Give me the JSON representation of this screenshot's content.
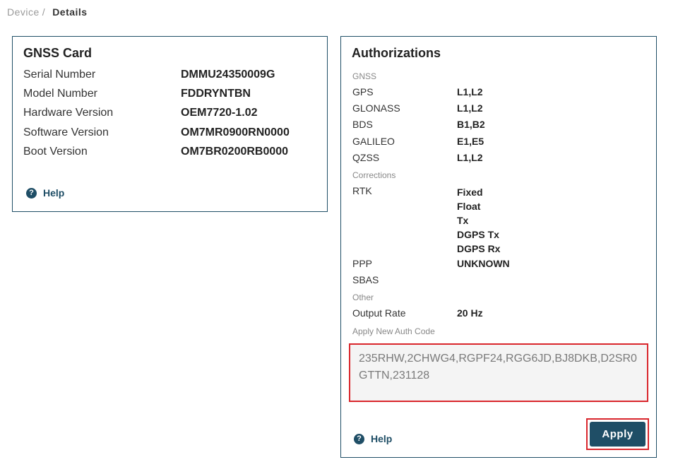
{
  "breadcrumb": {
    "root": "Device",
    "separator": "/",
    "current": "Details"
  },
  "gnss_card": {
    "title": "GNSS Card",
    "rows": [
      {
        "label": "Serial Number",
        "value": "DMMU24350009G"
      },
      {
        "label": "Model Number",
        "value": "FDDRYNTBN"
      },
      {
        "label": "Hardware Version",
        "value": "OEM7720-1.02"
      },
      {
        "label": "Software Version",
        "value": "OM7MR0900RN0000"
      },
      {
        "label": "Boot Version",
        "value": "OM7BR0200RB0000"
      }
    ],
    "help_label": "Help",
    "help_icon": "question-circle-icon"
  },
  "auth_card": {
    "title": "Authorizations",
    "gnss_section": "GNSS",
    "gnss_rows": [
      {
        "label": "GPS",
        "value": "L1,L2"
      },
      {
        "label": "GLONASS",
        "value": "L1,L2"
      },
      {
        "label": "BDS",
        "value": "B1,B2"
      },
      {
        "label": "GALILEO",
        "value": "E1,E5"
      },
      {
        "label": "QZSS",
        "value": "L1,L2"
      }
    ],
    "corrections_section": "Corrections",
    "rtk": {
      "label": "RTK",
      "values": [
        "Fixed",
        "Float",
        "Tx",
        "DGPS Tx",
        "DGPS Rx"
      ]
    },
    "ppp": {
      "label": "PPP",
      "value": "UNKNOWN"
    },
    "sbas": {
      "label": "SBAS",
      "value": ""
    },
    "other_section": "Other",
    "output_rate": {
      "label": "Output Rate",
      "value": "20 Hz"
    },
    "apply_section": "Apply New Auth Code",
    "auth_code_value": "235RHW,2CHWG4,RGPF24,RGG6JD,BJ8DKB,D2SR0GTTN,231128",
    "apply_label": "Apply",
    "help_label": "Help",
    "help_icon": "question-circle-icon"
  },
  "colors": {
    "primary": "#1f4e66",
    "highlight": "#d9262c",
    "input_bg": "#f4f4f4"
  }
}
